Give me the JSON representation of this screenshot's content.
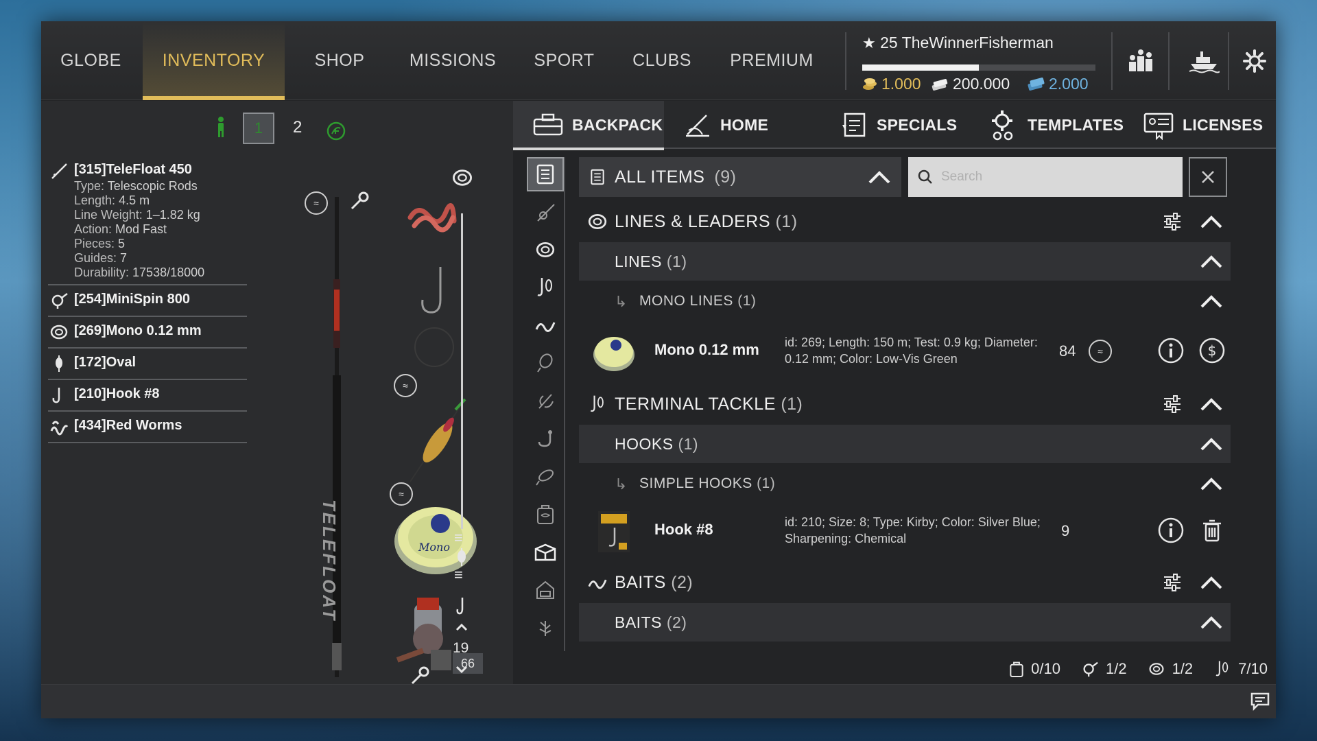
{
  "colors": {
    "accent": "#e2bd5a",
    "gold": "#e2bd5a",
    "credits": "#6fb3e0",
    "panel": "#232426"
  },
  "nav": {
    "tabs": [
      {
        "label": "GLOBE"
      },
      {
        "label": "INVENTORY",
        "active": true
      },
      {
        "label": "SHOP"
      },
      {
        "label": "MISSIONS"
      },
      {
        "label": "SPORT"
      },
      {
        "label": "CLUBS"
      },
      {
        "label": "PREMIUM"
      }
    ]
  },
  "player": {
    "level_name": "25 TheWinnerFisherman",
    "xp_fraction": 0.5,
    "gold": "1.000",
    "silver": "200.000",
    "credits": "2.000"
  },
  "rod_slots": {
    "selected": "1",
    "second": "2"
  },
  "tackle": [
    {
      "name": "[315]TeleFloat 450",
      "icon": "rod-icon",
      "details": [
        {
          "k": "Type:",
          "v": " Telescopic Rods"
        },
        {
          "k": "Length:",
          "v": " 4.5 m"
        },
        {
          "k": "Line Weight:",
          "v": " 1–1.82 kg"
        },
        {
          "k": "Action:",
          "v": " Mod Fast"
        },
        {
          "k": "Pieces:",
          "v": " 5"
        },
        {
          "k": "Guides:",
          "v": " 7"
        },
        {
          "k": "Durability:",
          "v": " 17538/18000"
        }
      ]
    },
    {
      "name": "[254]MiniSpin 800",
      "icon": "reel-icon"
    },
    {
      "name": "[269]Mono 0.12 mm",
      "icon": "line-spool-icon"
    },
    {
      "name": "[172]Oval",
      "icon": "float-icon"
    },
    {
      "name": "[210]Hook #8",
      "icon": "hook-icon"
    },
    {
      "name": "[434]Red Worms",
      "icon": "worms-icon"
    }
  ],
  "rod_labels": {
    "rod_brand": "TELEFLOAT",
    "line_count": "66",
    "hook_count": "19"
  },
  "subtabs": [
    {
      "label": "BACKPACK",
      "active": true
    },
    {
      "label": "HOME"
    },
    {
      "label": "SPECIALS"
    },
    {
      "label": "TEMPLATES"
    },
    {
      "label": "LICENSES"
    }
  ],
  "list": {
    "all_items": "ALL ITEMS",
    "all_items_count": "(9)",
    "search_placeholder": "Search",
    "sections": [
      {
        "label": "LINES & LEADERS",
        "count": "(1)"
      },
      {
        "label": "LINES",
        "count": "(1)"
      },
      {
        "label": "MONO LINES",
        "count": "(1)"
      },
      {
        "label": "TERMINAL TACKLE",
        "count": "(1)"
      },
      {
        "label": "HOOKS",
        "count": "(1)"
      },
      {
        "label": "SIMPLE HOOKS",
        "count": "(1)"
      },
      {
        "label": "BAITS",
        "count": "(2)"
      },
      {
        "label": "BAITS",
        "count": "(2)"
      }
    ],
    "items": [
      {
        "name": "Mono 0.12 mm",
        "desc": "id: 269; Length: 150 m; Test: 0.9 kg; Diameter: 0.12 mm; Color: Low-Vis Green",
        "qty": "84"
      },
      {
        "name": "Hook #8",
        "desc": "id: 210; Size: 8; Type: Kirby; Color: Silver Blue; Sharpening: Chemical",
        "qty": "9"
      }
    ]
  },
  "capacity": [
    {
      "icon": "bag-icon",
      "value": "0/10"
    },
    {
      "icon": "reel-icon",
      "value": "1/2"
    },
    {
      "icon": "line-spool-icon",
      "value": "1/2"
    },
    {
      "icon": "tackle-icon",
      "value": "7/10"
    }
  ]
}
